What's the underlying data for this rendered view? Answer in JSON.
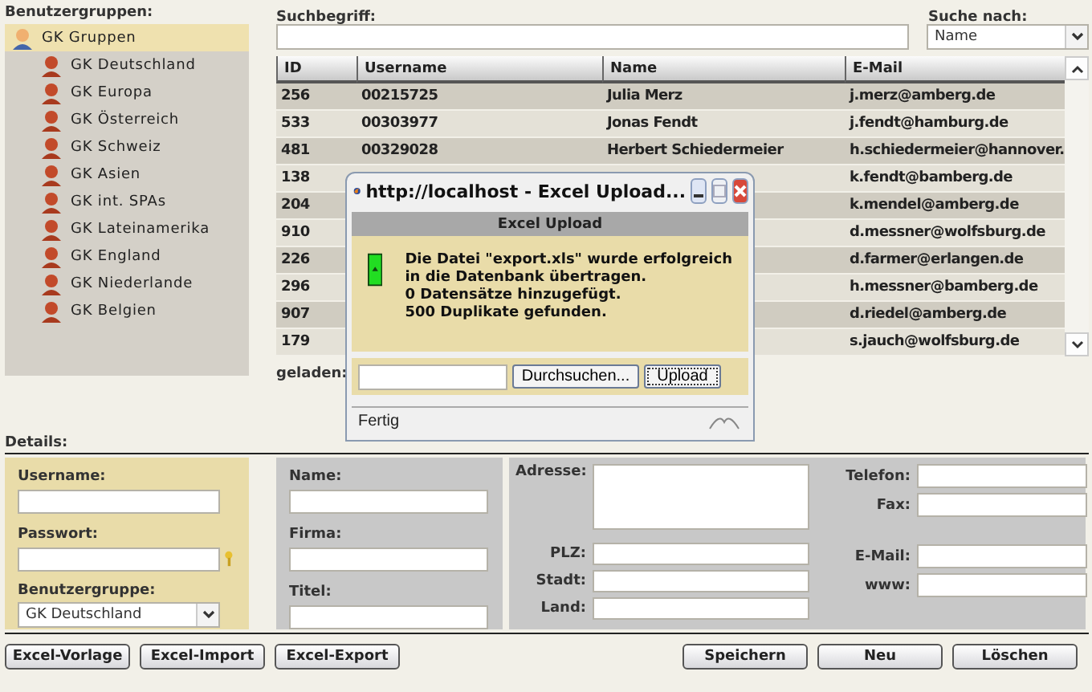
{
  "groups": {
    "label": "Benutzergruppen:",
    "tree": {
      "label": "GK Gruppen",
      "selected": true,
      "children": [
        {
          "label": "GK Deutschland",
          "selected": false
        },
        {
          "label": "GK Europa",
          "selected": false
        },
        {
          "label": "GK Österreich",
          "selected": false
        },
        {
          "label": "GK Schweiz",
          "selected": false
        },
        {
          "label": "GK Asien",
          "selected": false
        },
        {
          "label": "GK int. SPAs",
          "selected": false
        },
        {
          "label": "GK Lateinamerika",
          "selected": false
        },
        {
          "label": "GK England",
          "selected": false
        },
        {
          "label": "GK Niederlande",
          "selected": false
        },
        {
          "label": "GK Belgien",
          "selected": false
        }
      ]
    }
  },
  "search": {
    "label": "Suchbegriff:",
    "mode_label": "Suche nach:",
    "mode_value": "Name"
  },
  "table": {
    "columns": [
      "ID",
      "Username",
      "Name",
      "E-Mail"
    ],
    "rows": [
      {
        "id": "256",
        "username": "00215725",
        "name": "Julia Merz",
        "email": "j.merz@amberg.de"
      },
      {
        "id": "533",
        "username": "00303977",
        "name": "Jonas Fendt",
        "email": "j.fendt@hamburg.de"
      },
      {
        "id": "481",
        "username": "00329028",
        "name": "Herbert Schiedermeier",
        "email": "h.schiedermeier@hannover."
      },
      {
        "id": "138",
        "email": "k.fendt@bamberg.de"
      },
      {
        "id": "204",
        "email": "k.mendel@amberg.de"
      },
      {
        "id": "910",
        "email": "d.messner@wolfsburg.de"
      },
      {
        "id": "226",
        "email": "d.farmer@erlangen.de"
      },
      {
        "id": "296",
        "email": "h.messner@bamberg.de"
      },
      {
        "id": "907",
        "email": "d.riedel@amberg.de"
      },
      {
        "id": "179",
        "email": "s.jauch@wolfsburg.de"
      }
    ]
  },
  "upload_note": "geladen:",
  "details": {
    "label": "Details:",
    "account": {
      "username_label": "Username:",
      "password_label": "Passwort:",
      "group_label": "Benutzergruppe:",
      "group_value": "GK Deutschland"
    },
    "person": [
      "Name:",
      "Firma:",
      "Titel:"
    ],
    "address": {
      "address_label": "Adresse:",
      "left": [
        "PLZ:",
        "Stadt:",
        "Land:"
      ],
      "phone_label": "Telefon:",
      "fax_label": "Fax:",
      "right": [
        "E-Mail:",
        "www:"
      ]
    }
  },
  "buttons_left": [
    "Excel-Vorlage",
    "Excel-Import",
    "Excel-Export"
  ],
  "buttons_right": [
    "Speichern",
    "Neu",
    "Löschen"
  ],
  "dialog": {
    "title": "http://localhost - Excel Upload...",
    "heading": "Excel Upload",
    "message": [
      "Die Datei \"export.xls\" wurde erfolgreich",
      "in die Datenbank übertragen.",
      "0 Datensätze hinzugefügt.",
      "500 Duplikate gefunden."
    ],
    "browse": "Durchsuchen...",
    "upload": "Upload",
    "status": "Fertig"
  }
}
